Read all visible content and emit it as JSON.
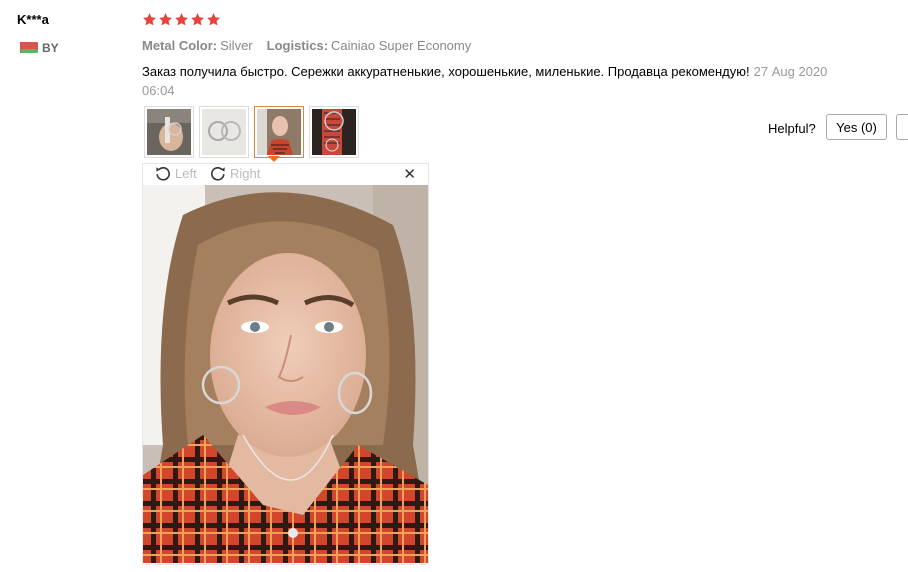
{
  "reviewer": {
    "name": "K***a",
    "country": "BY",
    "flag_icon": "belarus-flag-icon"
  },
  "rating": {
    "stars": 5,
    "max": 5,
    "color": "#e4473f"
  },
  "attributes": [
    {
      "key": "Metal Color:",
      "value": "Silver"
    },
    {
      "key": "Logistics:",
      "value": "Cainiao Super Economy"
    }
  ],
  "review": {
    "text": "Заказ получила быстро. Сережки аккуратненькие, хорошенькие, миленькие. Продавца рекомендую!",
    "date": "27 Aug 2020 06:04"
  },
  "thumbnails": [
    {
      "name": "review-photo-1",
      "active": false
    },
    {
      "name": "review-photo-2",
      "active": false
    },
    {
      "name": "review-photo-3",
      "active": true
    },
    {
      "name": "review-photo-4",
      "active": false
    }
  ],
  "viewer": {
    "rotate_left_label": "Left",
    "rotate_right_label": "Right",
    "close_icon": "close-icon"
  },
  "helpful": {
    "label": "Helpful?",
    "yes_label": "Yes (0)"
  },
  "colors": {
    "accent": "#f06a1f",
    "star": "#e4473f"
  }
}
